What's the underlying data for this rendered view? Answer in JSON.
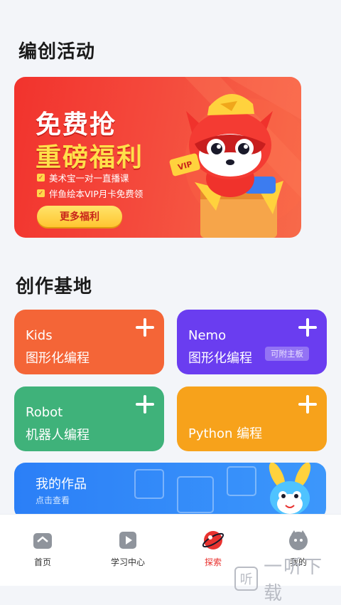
{
  "sections": {
    "activities_title": "编创活动",
    "base_title": "创作基地"
  },
  "banner": {
    "headline_1": "免费抢",
    "headline_2": "重磅福利",
    "bullets": [
      "美术宝一对一直播课",
      "伴鱼绘本VIP月卡免费领"
    ],
    "more_button": "更多福利",
    "badge_text": "VIP"
  },
  "cards": {
    "kids": {
      "line1": "Kids",
      "line2": "图形化编程"
    },
    "nemo": {
      "line1": "Nemo",
      "line2": "图形化编程",
      "tag": "可附主板"
    },
    "robot": {
      "line1": "Robot",
      "line2": "机器人编程"
    },
    "python": {
      "label": "Python 编程"
    }
  },
  "works": {
    "title": "我的作品",
    "subtitle": "点击查看"
  },
  "tabbar": {
    "items": [
      {
        "label": "首页",
        "icon": "home-icon"
      },
      {
        "label": "学习中心",
        "icon": "play-icon"
      },
      {
        "label": "探索",
        "icon": "planet-icon"
      },
      {
        "label": "我的",
        "icon": "profile-icon"
      }
    ],
    "active": "探索"
  },
  "watermark": {
    "logo_char": "听",
    "text": "一听下载"
  },
  "colors": {
    "accent_red": "#e83330",
    "kids_orange": "#f46537",
    "nemo_purple": "#6a3df0",
    "robot_green": "#3fb27a",
    "python_yellow": "#f7a21b",
    "works_blue": "#2b7ff7"
  }
}
